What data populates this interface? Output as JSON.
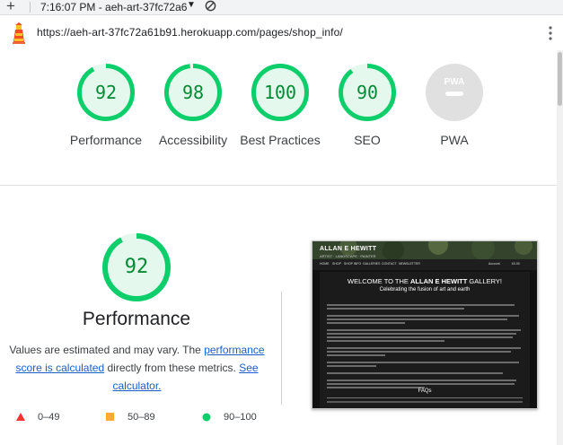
{
  "status_bar": {
    "plus_icon": "plus-icon",
    "time_text": "7:16:07 PM - aeh-art-37fc72a6",
    "caret": "▼"
  },
  "url_bar": {
    "url": "https://aeh-art-37fc72a61b91.herokuapp.com/pages/shop_info/"
  },
  "categories": [
    {
      "score": "92",
      "label": "Performance",
      "value": 92
    },
    {
      "score": "98",
      "label": "Accessibility",
      "value": 98
    },
    {
      "score": "100",
      "label": "Best Practices",
      "value": 100
    },
    {
      "score": "90",
      "label": "SEO",
      "value": 90
    },
    {
      "score": "PWA",
      "label": "PWA",
      "value": null
    }
  ],
  "performance": {
    "score": "92",
    "value": 92,
    "title": "Performance",
    "desc_1": "Values are estimated and may vary. The",
    "link_score": "performance score is calculated",
    "desc_2": " directly from these metrics. ",
    "link_calc": "See calculator."
  },
  "legend": [
    {
      "range": "0–49",
      "color": "#ff3333",
      "shape": "triangle"
    },
    {
      "range": "50–89",
      "color": "#ffaa33",
      "shape": "square"
    },
    {
      "range": "90–100",
      "color": "#0cce6b",
      "shape": "circle"
    }
  ],
  "colors": {
    "pass_arc": "#0cce6b",
    "pass_text": "#008a33",
    "pass_fill": "#e5f8ee",
    "pwa_gray": "#e0e0e0"
  },
  "screenshot_preview": {
    "logo": "ALLAN E HEWITT",
    "logo_sub": "ARTIST · LANDSCAPE · PAINTER",
    "nav_items": [
      "HOME",
      "SHOP",
      "SHOP INFO",
      "GALLERIES",
      "CONTACT",
      "NEWSLETTER"
    ],
    "account": "Account",
    "cart": "£0.00",
    "welcome_pre": "WELCOME TO THE ",
    "welcome_bold": "ALLAN E HEWITT",
    "welcome_post": " GALLERY!",
    "subtitle": "Celebrating the fusion of art and earth",
    "faqs": "FAQs"
  }
}
